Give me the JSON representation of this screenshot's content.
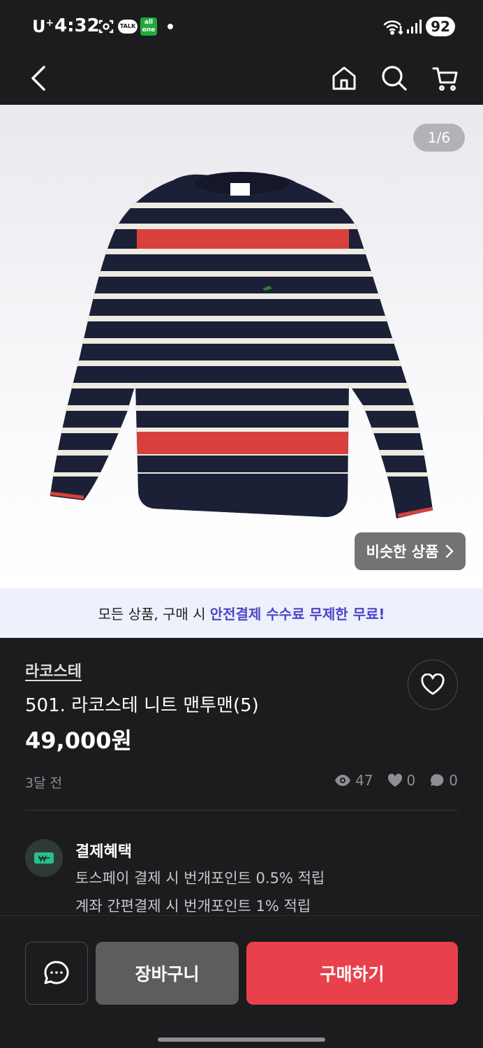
{
  "status_bar": {
    "carrier": "U",
    "carrier_sup": "+",
    "time": "4:32",
    "talk_label": "TALK",
    "allone_label": "all one",
    "battery": "92"
  },
  "gallery": {
    "counter": "1/6",
    "similar_label": "비슷한 상품"
  },
  "promo": {
    "text": "모든 상품, 구매 시",
    "highlight": "안전결제 수수료 무제한 무료!"
  },
  "product": {
    "brand": "라코스테",
    "title": "501. 라코스테 니트 맨투맨(5)",
    "price": "49,000원",
    "time_ago": "3달 전",
    "views": "47",
    "likes": "0",
    "chats": "0"
  },
  "benefit": {
    "title": "결제혜택",
    "lines": [
      "토스페이 결제 시 번개포인트 0.5% 적립",
      "계좌 간편결제 시 번개포인트 1% 적립"
    ]
  },
  "actions": {
    "cart_label": "장바구니",
    "buy_label": "구매하기"
  },
  "colors": {
    "accent_red": "#e8414b",
    "promo_highlight": "#4a46c8",
    "background": "#1c1c1e"
  }
}
